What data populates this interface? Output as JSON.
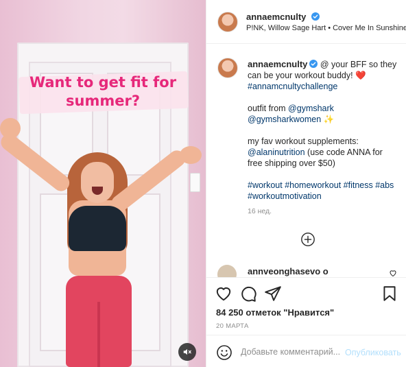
{
  "video": {
    "caption": "Want to get fit for summer?",
    "mute_icon": "speaker-muted-icon"
  },
  "header": {
    "username": "annaemcnulty",
    "audio": "P!NK, Willow Sage Hart • Cover Me In Sunshine"
  },
  "post_caption": {
    "username": "annaemcnulty",
    "line1_text": " @ your BFF so they can be your workout buddy! ",
    "heart_emoji": "❤️",
    "hashtag_challenge": "#annamcnultychallenge",
    "outfit_text": "outfit from ",
    "outfit_mention1": "@gymshark",
    "outfit_mention2": "@gymsharkwomen",
    "sparkle_emoji": "✨",
    "supp_text": "my fav workout supplements:",
    "supp_mention": "@alaninutrition",
    "supp_rest": " (use code ANNA for free shipping over $50)",
    "hashtags": "#workout #homeworkout #fitness #abs #workoutmotivation",
    "time_ago": "16 нед."
  },
  "next_comment": {
    "username": "annveonghasevo o"
  },
  "actions": {
    "likes": "84 250 отметок \"Нравится\"",
    "date": "20 МАРТА"
  },
  "composer": {
    "placeholder": "Добавьте комментарий...",
    "post_label": "Опубликовать"
  },
  "colors": {
    "caption_pink": "#e6287a",
    "link_blue": "#00376b",
    "verified_blue": "#3897f0",
    "post_disabled": "#b2dffc"
  }
}
